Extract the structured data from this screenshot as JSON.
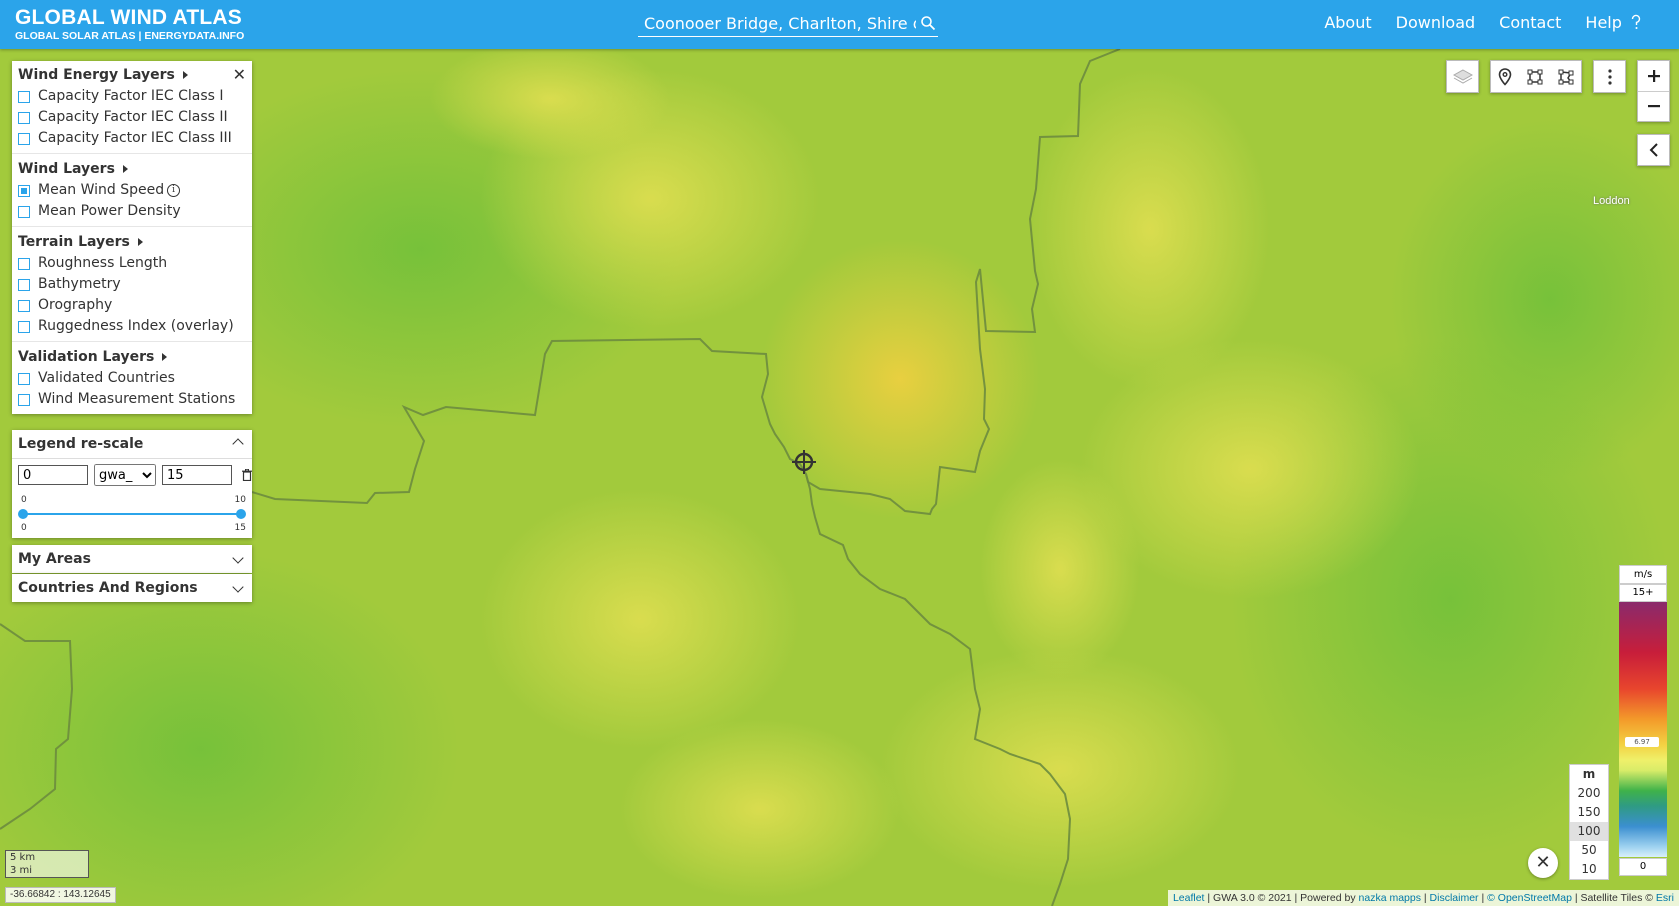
{
  "header": {
    "title": "GLOBAL WIND ATLAS",
    "subtitle": "GLOBAL SOLAR ATLAS | ENERGYDATA.INFO",
    "search_value": "Coonooer Bridge, Charlton, Shire of B",
    "nav": [
      "About",
      "Download",
      "Contact",
      "Help"
    ]
  },
  "layers_panel": {
    "groups": [
      {
        "title": "Wind Energy Layers",
        "items": [
          {
            "label": "Capacity Factor IEC Class I",
            "checked": false
          },
          {
            "label": "Capacity Factor IEC Class II",
            "checked": false
          },
          {
            "label": "Capacity Factor IEC Class III",
            "checked": false
          }
        ]
      },
      {
        "title": "Wind Layers",
        "items": [
          {
            "label": "Mean Wind Speed",
            "checked": true
          },
          {
            "label": "Mean Power Density",
            "checked": false
          }
        ]
      },
      {
        "title": "Terrain Layers",
        "items": [
          {
            "label": "Roughness Length",
            "checked": false
          },
          {
            "label": "Bathymetry",
            "checked": false
          },
          {
            "label": "Orography",
            "checked": false
          },
          {
            "label": "Ruggedness Index (overlay)",
            "checked": false
          }
        ]
      },
      {
        "title": "Validation Layers",
        "items": [
          {
            "label": "Validated Countries",
            "checked": false
          },
          {
            "label": "Wind Measurement Stations",
            "checked": false
          }
        ]
      }
    ]
  },
  "legend_rescale": {
    "title": "Legend re-scale",
    "min_value": "0",
    "palette": "gwa_",
    "max_value": "15",
    "slider_top_left": "0",
    "slider_top_right": "10",
    "slider_bottom_left": "0",
    "slider_bottom_right": "15"
  },
  "accordions": {
    "my_areas": "My Areas",
    "countries": "Countries And Regions"
  },
  "map": {
    "region_label": "Loddon",
    "scale_km": "5 km",
    "scale_mi": "3 mi",
    "coordinates": "-36.66842 : 143.12645"
  },
  "legend": {
    "unit": "m/s",
    "max_label": "15+",
    "min_label": "0",
    "marker_value": "6.97"
  },
  "heights": {
    "unit": "m",
    "options": [
      "200",
      "150",
      "100",
      "50",
      "10"
    ],
    "selected": "100"
  },
  "attribution": {
    "leaflet": "Leaflet",
    "gwa": " | GWA 3.0 © 2021 | Powered by ",
    "nazka": "nazka mapps",
    "sep1": " | ",
    "disclaimer": "Disclaimer",
    "sep2": " | ",
    "osm": "© OpenStreetMap",
    "tiles": " | Satellite Tiles © ",
    "esri": "Esri"
  },
  "colors": {
    "header_blue": "#2ba4ea",
    "map_base": "#9cc83a"
  }
}
